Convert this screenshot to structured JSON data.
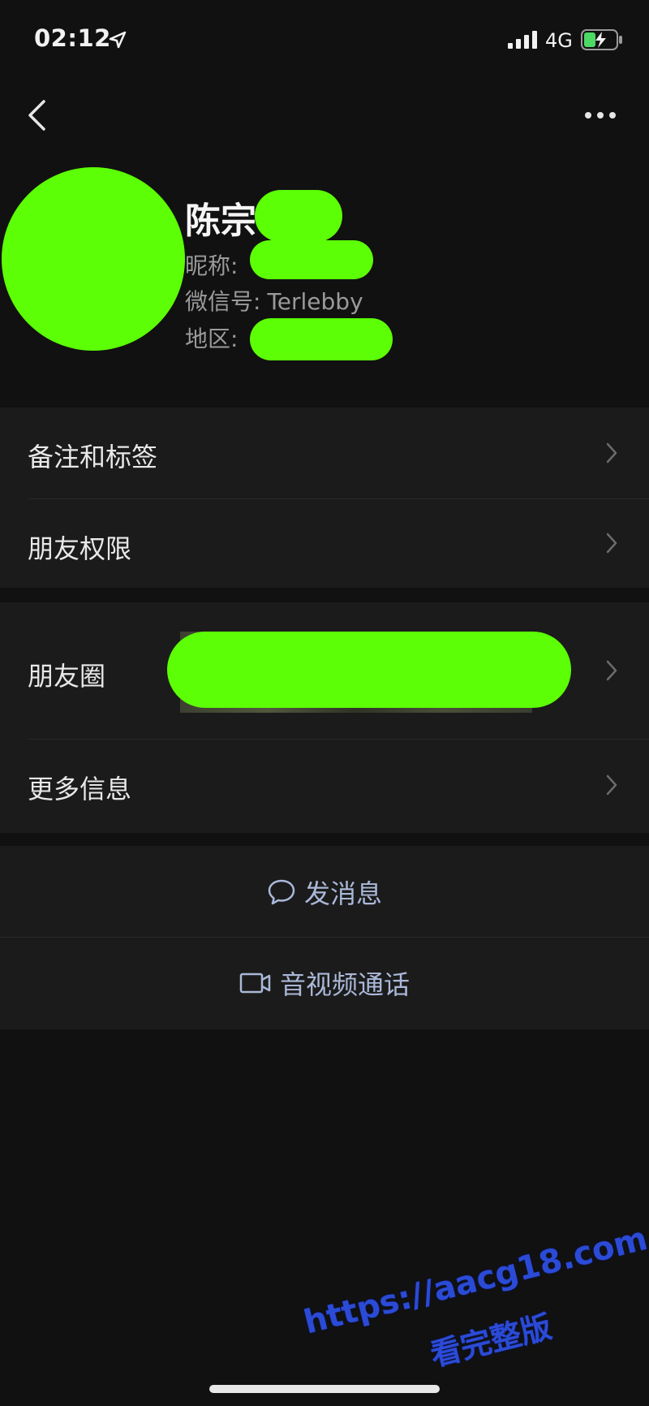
{
  "status_bar": {
    "time": "02:12",
    "network": "4G"
  },
  "profile": {
    "name": "陈宗",
    "nickname_label": "昵称:",
    "wechat_id_label": "微信号:",
    "wechat_id_value": "Terlebby",
    "region_label": "地区:"
  },
  "menu": {
    "remarks_tags": "备注和标签",
    "friend_permissions": "朋友权限",
    "moments": "朋友圈",
    "more_info": "更多信息"
  },
  "actions": {
    "send_message": "发消息",
    "video_call": "音视频通话"
  },
  "watermark": {
    "line1": "https://aacg18.com",
    "line2": "看完整版"
  },
  "colors": {
    "background": "#111111",
    "row_background": "#1b1b1b",
    "redaction": "#5cff05",
    "action_text": "#aab8d8"
  }
}
